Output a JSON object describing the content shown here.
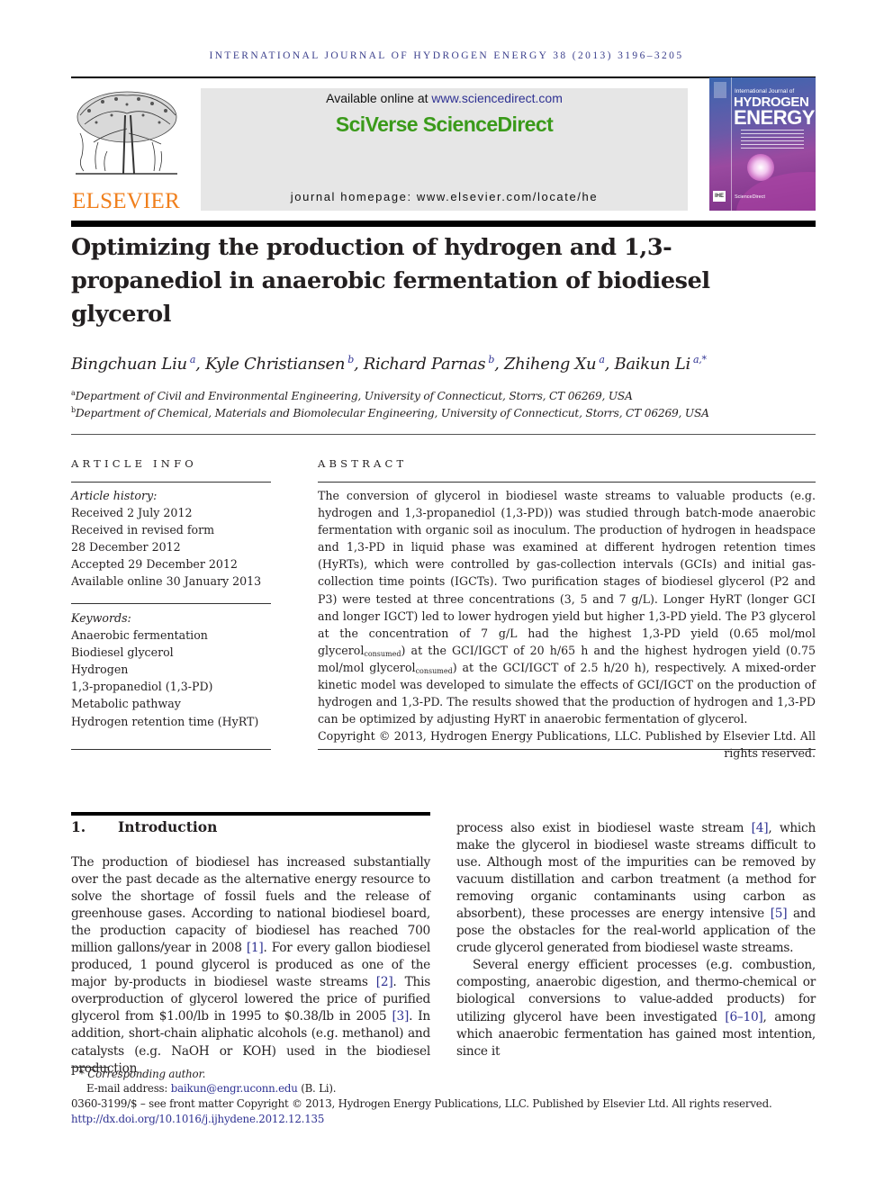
{
  "running_header": "INTERNATIONAL JOURNAL OF HYDROGEN ENERGY 38 (2013) 3196–3205",
  "publisher": {
    "logo_icon": "elsevier-tree-icon",
    "name": "ELSEVIER",
    "color": "#f07f1c"
  },
  "banner": {
    "available_prefix": "Available online at ",
    "available_link": "www.sciencedirect.com",
    "platform_name": "SciVerse ScienceDirect",
    "platform_color": "#3a9a1a",
    "homepage": "journal homepage: www.elsevier.com/locate/he"
  },
  "cover": {
    "line1": "International Journal of",
    "line2": "HYDROGEN",
    "line3": "ENERGY",
    "badge": "IHE",
    "footer": "ScienceDirect"
  },
  "article": {
    "title": "Optimizing the production of hydrogen and 1,3-propanediol in anaerobic fermentation of biodiesel glycerol",
    "authors": [
      {
        "name": "Bingchuan Liu",
        "aff": "a"
      },
      {
        "name": "Kyle Christiansen",
        "aff": "b"
      },
      {
        "name": "Richard Parnas",
        "aff": "b"
      },
      {
        "name": "Zhiheng Xu",
        "aff": "a"
      },
      {
        "name": "Baikun Li",
        "aff": "a,*"
      }
    ],
    "affiliations": [
      {
        "key": "a",
        "text": "Department of Civil and Environmental Engineering, University of Connecticut, Storrs, CT 06269, USA"
      },
      {
        "key": "b",
        "text": "Department of Chemical, Materials and Biomolecular Engineering, University of Connecticut, Storrs, CT 06269, USA"
      }
    ]
  },
  "article_info": {
    "heading": "ARTICLE INFO",
    "history_label": "Article history:",
    "history": [
      "Received 2 July 2012",
      "Received in revised form",
      "28 December 2012",
      "Accepted 29 December 2012",
      "Available online 30 January 2013"
    ],
    "keywords_label": "Keywords:",
    "keywords": [
      "Anaerobic fermentation",
      "Biodiesel glycerol",
      "Hydrogen",
      "1,3-propanediol (1,3-PD)",
      "Metabolic pathway",
      "Hydrogen retention time (HyRT)"
    ]
  },
  "abstract": {
    "heading": "ABSTRACT",
    "part1": "The conversion of glycerol in biodiesel waste streams to valuable products (e.g. hydrogen and 1,3-propanediol (1,3-PD)) was studied through batch-mode anaerobic fermentation with organic soil as inoculum. The production of hydrogen in headspace and 1,3-PD in liquid phase was examined at different hydrogen retention times (HyRTs), which were controlled by gas-collection intervals (GCIs) and initial gas-collection time points (IGCTs). Two purification stages of biodiesel glycerol (P2 and P3) were tested at three concentrations (3, 5 and 7 g/L). Longer HyRT (longer GCI and longer IGCT) led to lower hydrogen yield but higher 1,3-PD yield. The P3 glycerol at the concentration of 7 g/L had the highest 1,3-PD yield (0.65 mol/mol glycerol",
    "sub1": "consumed",
    "part2": ") at the GCI/IGCT of 20 h/65 h and the highest hydro­gen yield (0.75 mol/mol glycerol",
    "sub2": "consumed",
    "part3": ") at the GCI/IGCT of 2.5 h/20 h), respectively. A mixed-order kinetic model was developed to simulate the effects of GCI/IGCT on the production of hydrogen and 1,3-PD. The results showed that the production of hydrogen and 1,3-PD can be optimized by adjusting HyRT in anaerobic fermentation of glycerol.",
    "copyright": "Copyright © 2013, Hydrogen Energy Publications, LLC. Published by Elsevier Ltd. All rights reserved."
  },
  "introduction": {
    "number": "1.",
    "heading": "Introduction",
    "left": {
      "s1": "The production of biodiesel has increased substantially over the past decade as the alternative energy resource to solve the shortage of fossil fuels and the release of greenhouse gases. According to national biodiesel board, the production capacity of biodiesel has reached 700 million gallons/year in 2008 ",
      "c1": "[1]",
      "s2": ". For every gallon biodiesel produced, 1 pound glycerol is pro­duced as one of the major by-products in biodiesel waste streams ",
      "c2": "[2]",
      "s3": ". This overproduction of glycerol lowered the price of purified glycerol from $1.00/lb in 1995 to $0.38/lb in 2005 ",
      "c3": "[3]",
      "s4": ". In addition, short-chain aliphatic alcohols (e.g. methanol) and catalysts (e.g. NaOH or KOH) used in the biodiesel production"
    },
    "right": {
      "s1": "process also exist in biodiesel waste stream ",
      "c4": "[4]",
      "s2": ", which make the glycerol in biodiesel waste streams difficult to use. Although most of the impurities can be removed by vacuum distillation and carbon treatment (a method for removing organic contaminants using carbon as absorbent), these pro­cesses are energy intensive ",
      "c5": "[5]",
      "s3": " and pose the obstacles for the real-world application of the crude glycerol generated from biodiesel waste streams.",
      "p2_s1": "Several energy efficient processes (e.g. combustion, com­posting, anaerobic digestion, and thermo-chemical or bio­logical conversions to value-added products) for utilizing glycerol have been investigated ",
      "c6": "[6–10]",
      "p2_s2": ", among which anae­robic fermentation has gained most intention, since it"
    }
  },
  "footnotes": {
    "corresponding": "* Corresponding author.",
    "email_label": "E-mail address: ",
    "email": "baikun@engr.uconn.edu",
    "email_suffix": " (B. Li).",
    "issn_line": "0360-3199/$ – see front matter Copyright © 2013, Hydrogen Energy Publications, LLC. Published by Elsevier Ltd. All rights reserved.",
    "doi": "http://dx.doi.org/10.1016/j.ijhydene.2012.12.135"
  },
  "colors": {
    "link": "#2e3192",
    "running_header": "#3b3f8c",
    "banner_bg": "#e6e6e6"
  }
}
